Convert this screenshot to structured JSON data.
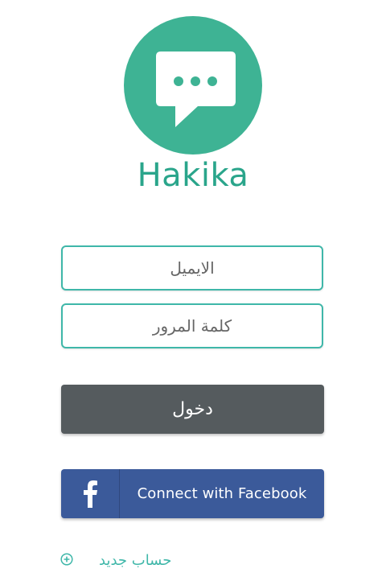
{
  "app": {
    "name": "Hakika",
    "logo_icon": "chat-bubble-icon",
    "brand_color": "#3eb394",
    "accent_color": "#3fb7a9"
  },
  "login_form": {
    "email_placeholder": "الايميل",
    "password_placeholder": "كلمة المرور",
    "login_label": "دخول",
    "login_color": "#555b5e"
  },
  "facebook": {
    "label": "Connect with Facebook",
    "icon": "facebook-f-icon",
    "color": "#3b5a9a"
  },
  "footer": {
    "new_account_label": "حساب جديد",
    "icon": "plus-circle-icon"
  }
}
